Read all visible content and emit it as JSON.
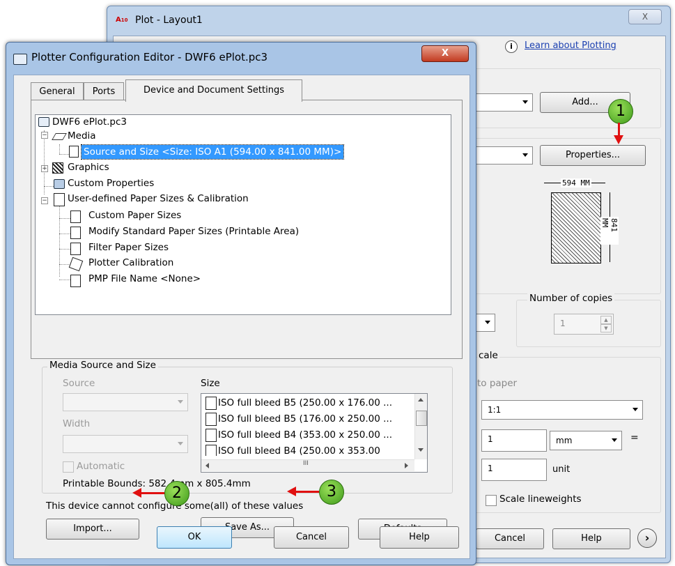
{
  "plot_window": {
    "app_icon": "autocad-logo-icon",
    "title": "Plot - Layout1",
    "close_label": "X",
    "info_icon": "info-icon",
    "learn_link": "Learn about Plotting",
    "add_button": "Add...",
    "properties_button": "Properties...",
    "paper_width_label": "594 MM",
    "paper_height_label": "841 MM",
    "copies_group": "Number of copies",
    "copies_value": "1",
    "scale_group_partial": "cale",
    "fit_label_partial": "to paper",
    "scale_value": "1:1",
    "scale_num": "1",
    "scale_unit_select": "mm",
    "scale_equals": "=",
    "scale_den": "1",
    "scale_unit_label": "unit",
    "scale_lineweights": "Scale lineweights",
    "cancel_button": "Cancel",
    "help_button": "Help",
    "expand_icon": "chevron-right-circle-icon"
  },
  "editor": {
    "title": "Plotter Configuration Editor - DWF6 ePlot.pc3",
    "close_label": "X",
    "tabs": [
      "General",
      "Ports",
      "Device and Document Settings"
    ],
    "tree": {
      "root": "DWF6 ePlot.pc3",
      "media": "Media",
      "source_size": "Source and Size <Size: ISO A1 (594.00 x 841.00 MM)>",
      "graphics": "Graphics",
      "custom_properties": "Custom Properties",
      "user_defined": "User-defined Paper Sizes & Calibration",
      "custom_paper": "Custom Paper Sizes",
      "modify_standard": "Modify Standard Paper Sizes (Printable Area)",
      "filter_paper": "Filter Paper Sizes",
      "plotter_cal": "Plotter Calibration",
      "pmp_file": "PMP File Name <None>"
    },
    "media_group": "Media Source and Size",
    "source_label": "Source",
    "width_label": "Width",
    "size_label": "Size",
    "automatic_label": "Automatic",
    "size_items": [
      "ISO full bleed B5 (250.00 x 176.00 ...",
      "ISO full bleed B5 (176.00 x 250.00 ...",
      "ISO full bleed B4 (353.00 x 250.00 ...",
      "ISO full bleed B4 (250.00 x 353.00"
    ],
    "scroll_mid_label": "III",
    "printable_bounds": "Printable Bounds: 582.4mm x 805.4mm",
    "device_note": "This device cannot configure some(all) of these values",
    "import_button": "Import...",
    "save_as_button": "Save As...",
    "defaults_button": "Defaults",
    "ok_button": "OK",
    "cancel_button": "Cancel",
    "help_button": "Help"
  },
  "callouts": [
    "1",
    "2",
    "3"
  ],
  "colors": {
    "callout_green": "#5cc12a",
    "arrow_red": "#e01010",
    "selection_blue": "#3399ff"
  }
}
